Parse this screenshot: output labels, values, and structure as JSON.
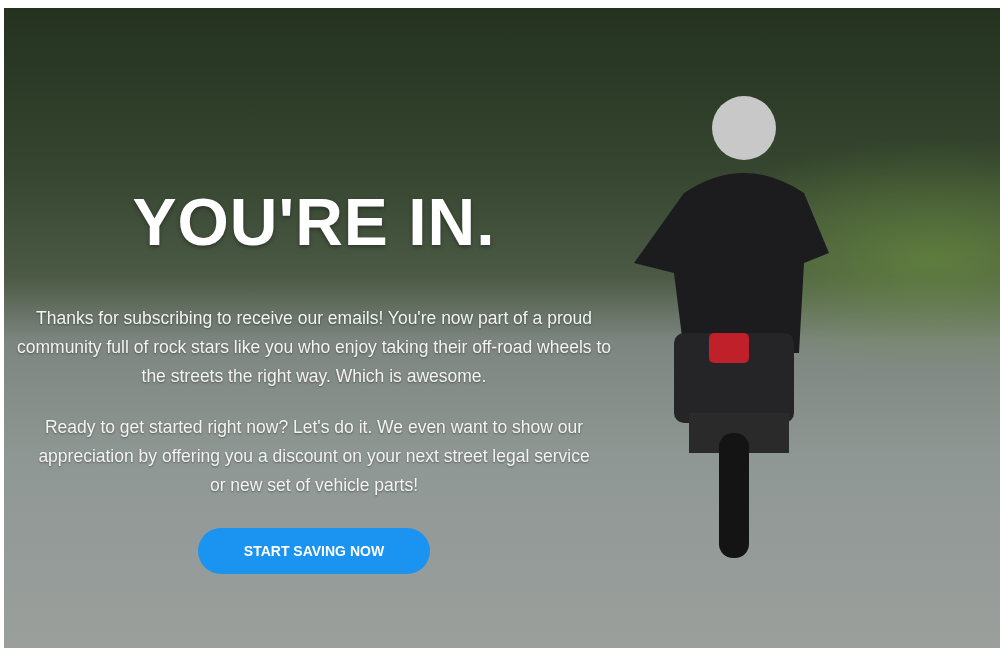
{
  "hero": {
    "heading": "YOU'RE IN.",
    "paragraphs": [
      "Thanks for subscribing to receive our emails! You're now part of a proud community full of rock stars like you who enjoy taking their off-road wheels to the streets the right way. Which is awesome.",
      "Ready to get started right now? Let's do it. We even want to show our appreciation by offering you a discount on your next street legal service or new set of vehicle parts!"
    ],
    "button": "START SAVING NOW"
  }
}
